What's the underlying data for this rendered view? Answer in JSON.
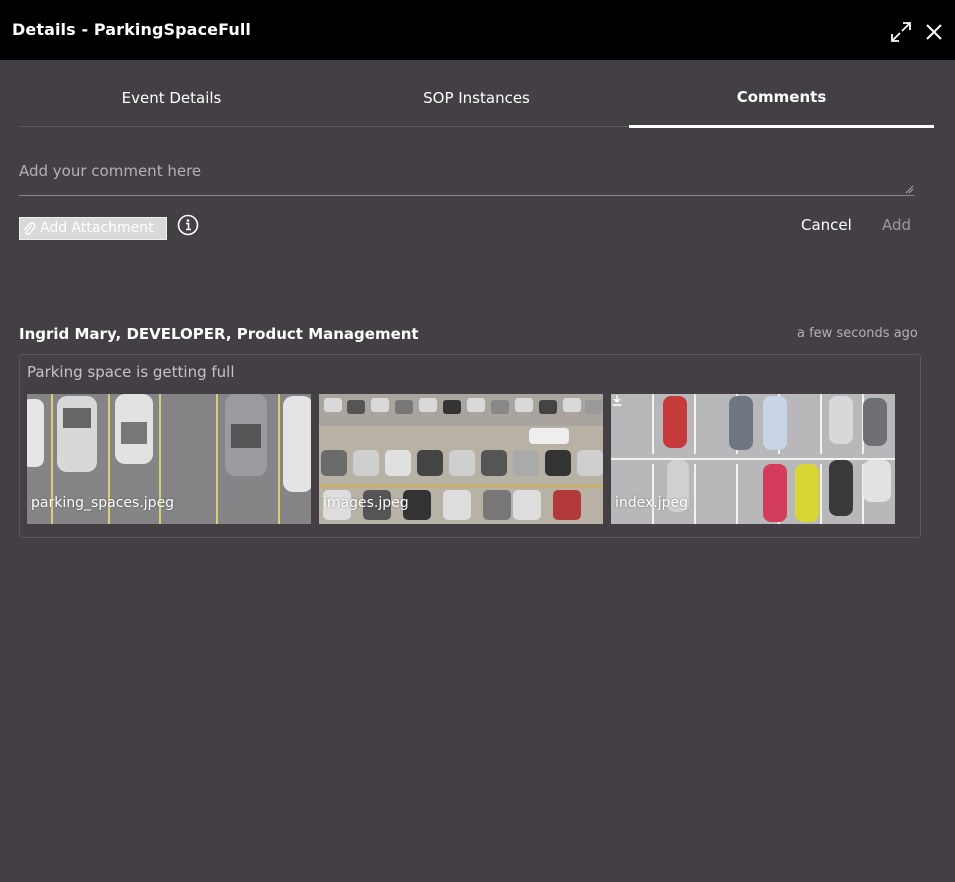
{
  "window": {
    "title": "Details - ParkingSpaceFull",
    "expand_icon": "expand-icon",
    "close_icon": "close-icon"
  },
  "tabs": [
    {
      "label": "Event Details",
      "active": false
    },
    {
      "label": "SOP Instances",
      "active": false
    },
    {
      "label": "Comments",
      "active": true
    }
  ],
  "composer": {
    "placeholder": "Add your comment here",
    "value": "",
    "attach_label": "Add Attachment",
    "attach_icon": "paperclip-icon",
    "info_icon": "info-icon",
    "cancel_label": "Cancel",
    "add_label": "Add"
  },
  "comments": [
    {
      "author": "Ingrid Mary, DEVELOPER,  Product Management",
      "time": "a few seconds ago",
      "text": "Parking space is getting full",
      "attachments": [
        {
          "name": "parking_spaces.jpeg"
        },
        {
          "name": "images.jpeg"
        },
        {
          "name": "index.jpeg",
          "download_icon": "download-icon"
        }
      ]
    }
  ],
  "colors": {
    "background": "#433f45",
    "titlebar": "#000000",
    "text": "#ffffff",
    "muted": "#b4b1b5",
    "disabled": "#9c989e"
  }
}
